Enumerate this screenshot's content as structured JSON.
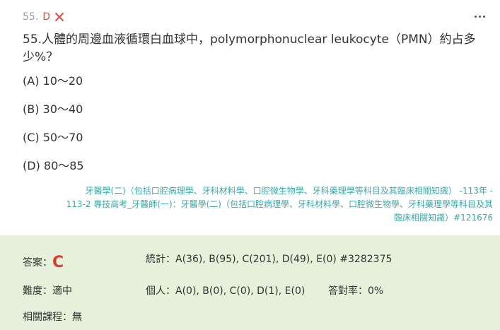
{
  "question": {
    "number": "55.",
    "user_answer": "D",
    "result_icon": "x-mark-icon",
    "text_line1": "55.人體的周邊血液循環白血球中，polymorphonuclear leukocyte（PMN）約占多",
    "text_line2": "少%？",
    "options": [
      {
        "label": "(A) 10～20"
      },
      {
        "label": "(B) 30～40"
      },
      {
        "label": "(C) 50～70"
      },
      {
        "label": "(D) 80～85"
      }
    ],
    "source_line1": "牙醫學(二)（包括口腔病理學、牙科材料學、口腔微生物學、牙科藥理學等科目及其臨床相關知識） -113年 -",
    "source_line2": "113-2 專技高考_牙醫師(一)：牙醫學(二)（包括口腔病理學、牙科材料學、口腔微生物學、牙科藥理學等科目及其",
    "source_line3": "臨床相關知識）#121676"
  },
  "stats": {
    "answer_label": "答案：",
    "answer_value": "C",
    "difficulty": "難度：適中",
    "course": "相關課程：無",
    "statistics": "統計：A(36), B(95), C(201), D(49), E(0) #3282375",
    "personal": "個人：A(0), B(0), C(0), D(1), E(0)",
    "accuracy": "答對率：0%"
  },
  "colors": {
    "wrong": "#d9534f",
    "answer": "#e03a2e",
    "link": "#3aa8a8",
    "panel": "#e6f1dc"
  }
}
